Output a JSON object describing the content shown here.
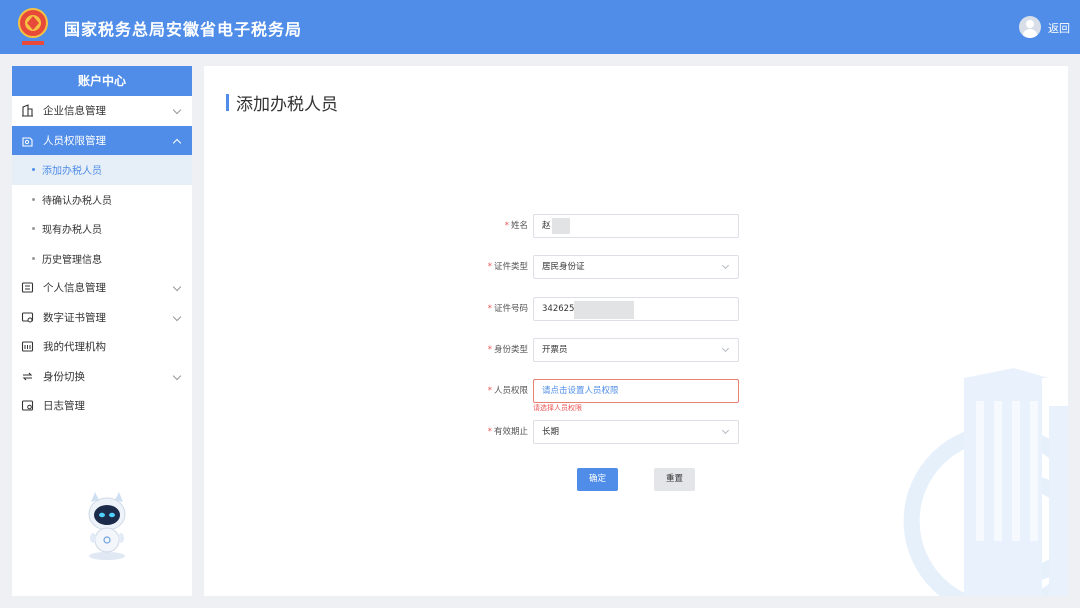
{
  "header": {
    "title": "国家税务总局安徽省电子税务局",
    "back_label": "返回"
  },
  "sidebar": {
    "title": "账户中心",
    "items": [
      {
        "label": "企业信息管理",
        "icon": "building-icon",
        "expandable": true
      },
      {
        "label": "人员权限管理",
        "icon": "user-permission-icon",
        "expandable": true,
        "active": true,
        "children": [
          {
            "label": "添加办税人员",
            "current": true
          },
          {
            "label": "待确认办税人员"
          },
          {
            "label": "现有办税人员"
          },
          {
            "label": "历史管理信息"
          }
        ]
      },
      {
        "label": "个人信息管理",
        "icon": "id-card-icon",
        "expandable": true
      },
      {
        "label": "数字证书管理",
        "icon": "certificate-icon",
        "expandable": true
      },
      {
        "label": "我的代理机构",
        "icon": "agency-icon",
        "expandable": false
      },
      {
        "label": "身份切换",
        "icon": "switch-icon",
        "expandable": true
      },
      {
        "label": "日志管理",
        "icon": "log-icon",
        "expandable": false
      }
    ]
  },
  "main": {
    "page_title": "添加办税人员",
    "form": {
      "name": {
        "label": "姓名",
        "value": "赵"
      },
      "id_type": {
        "label": "证件类型",
        "value": "居民身份证"
      },
      "id_number": {
        "label": "证件号码",
        "value": "342625"
      },
      "role_type": {
        "label": "身份类型",
        "value": "开票员"
      },
      "permission": {
        "label": "人员权限",
        "placeholder": "请点击设置人员权限",
        "error": "请选择人员权限"
      },
      "validity": {
        "label": "有效期止",
        "value": "长期"
      }
    },
    "buttons": {
      "confirm": "确定",
      "reset": "重置"
    }
  },
  "colors": {
    "primary": "#4f8de8",
    "error": "#e55555",
    "page_bg": "#eef0f4"
  }
}
